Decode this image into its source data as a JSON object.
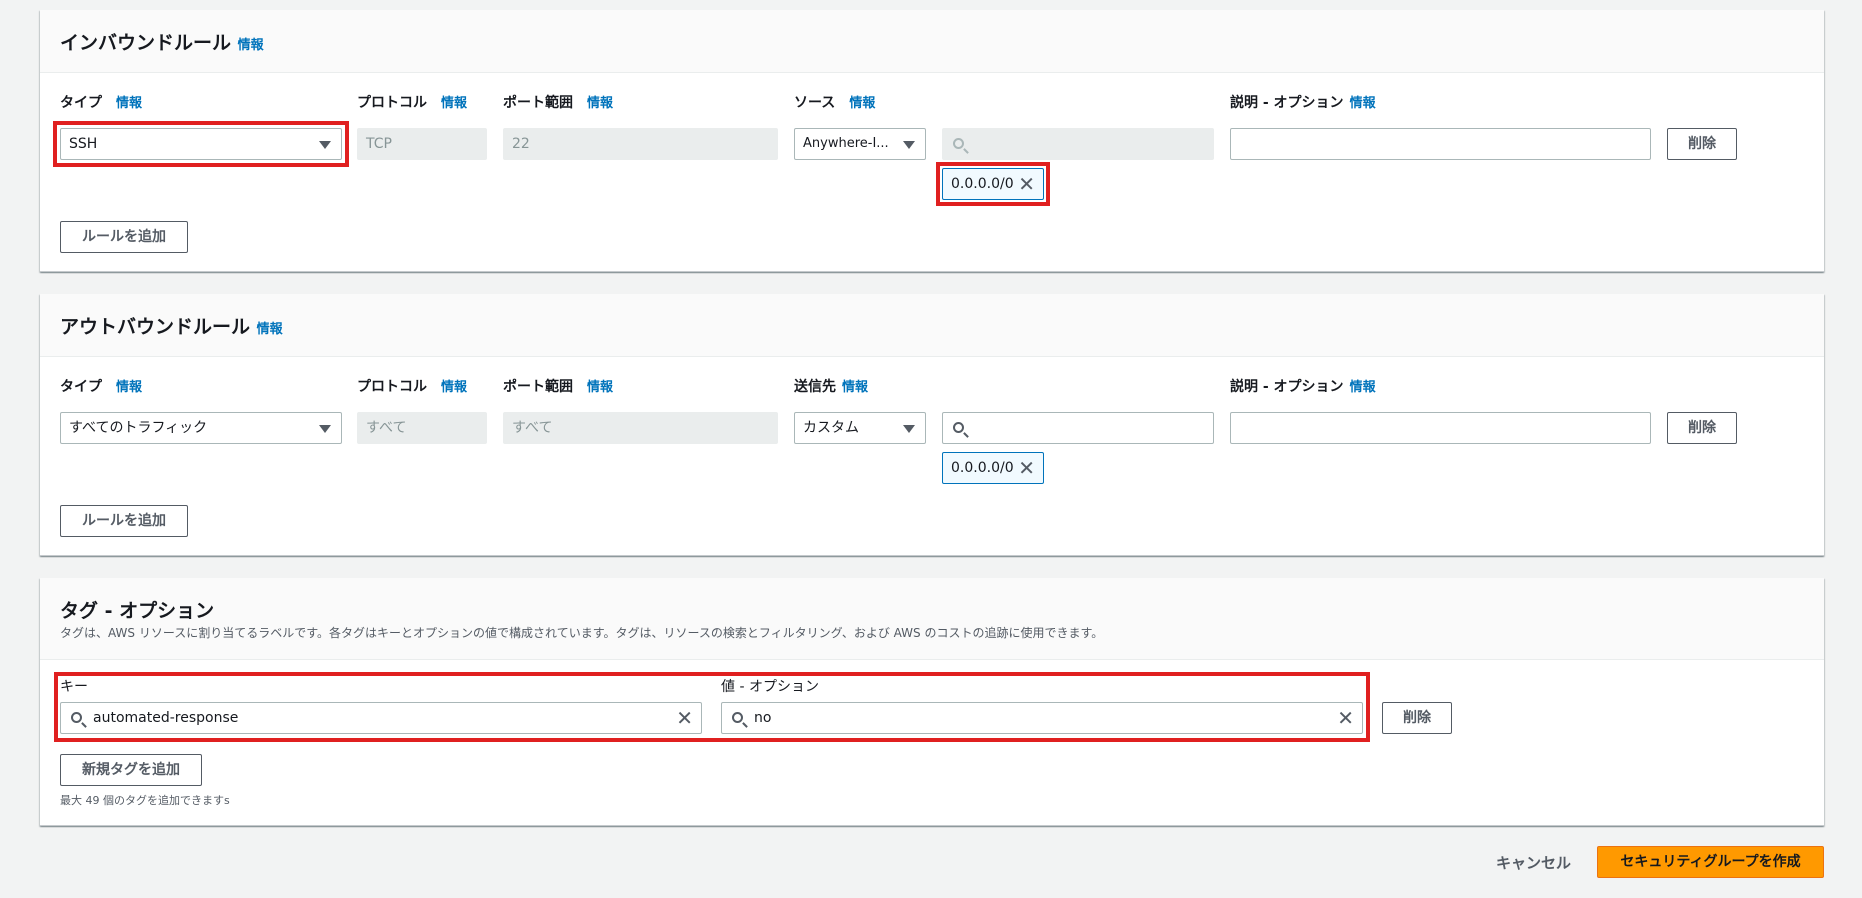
{
  "inbound": {
    "title": "インバウンドルール",
    "info": "情報",
    "columns": {
      "type": "タイプ",
      "protocol": "プロトコル",
      "port_range": "ポート範囲",
      "source": "ソース",
      "description": "説明 - オプション"
    },
    "rule": {
      "type_value": "SSH",
      "protocol_value": "TCP",
      "port_value": "22",
      "source_select": "Anywhere-I...",
      "source_search_value": "",
      "cidr_token": "0.0.0.0/0",
      "description_value": ""
    },
    "delete_label": "削除",
    "add_rule_label": "ルールを追加"
  },
  "outbound": {
    "title": "アウトバウンドルール",
    "info": "情報",
    "columns": {
      "type": "タイプ",
      "protocol": "プロトコル",
      "port_range": "ポート範囲",
      "destination": "送信先",
      "description": "説明 - オプション"
    },
    "rule": {
      "type_value": "すべてのトラフィック",
      "protocol_value": "すべて",
      "port_value": "すべて",
      "destination_select": "カスタム",
      "destination_search_value": "",
      "cidr_token": "0.0.0.0/0",
      "description_value": ""
    },
    "delete_label": "削除",
    "add_rule_label": "ルールを追加"
  },
  "tags": {
    "title": "タグ - オプション",
    "description": "タグは、AWS リソースに割り当てるラベルです。各タグはキーとオプションの値で構成されています。タグは、リソースの検索とフィルタリング、および AWS のコストの追跡に使用できます。",
    "key_label": "キー",
    "value_label": "値 - オプション",
    "key_value": "automated-response",
    "value_value": "no",
    "delete_label": "削除",
    "add_tag_label": "新規タグを追加",
    "limit_note": "最大 49 個のタグを追加できますs"
  },
  "footer": {
    "cancel_label": "キャンセル",
    "create_label": "セキュリティグループを作成"
  },
  "icons": {
    "dropdown": "caret-down-icon",
    "search": "search-icon",
    "remove": "close-icon"
  },
  "colors": {
    "info_link": "#0073bb",
    "primary_button": "#ff9900",
    "highlight": "#e02020",
    "token_border": "#0073bb"
  }
}
